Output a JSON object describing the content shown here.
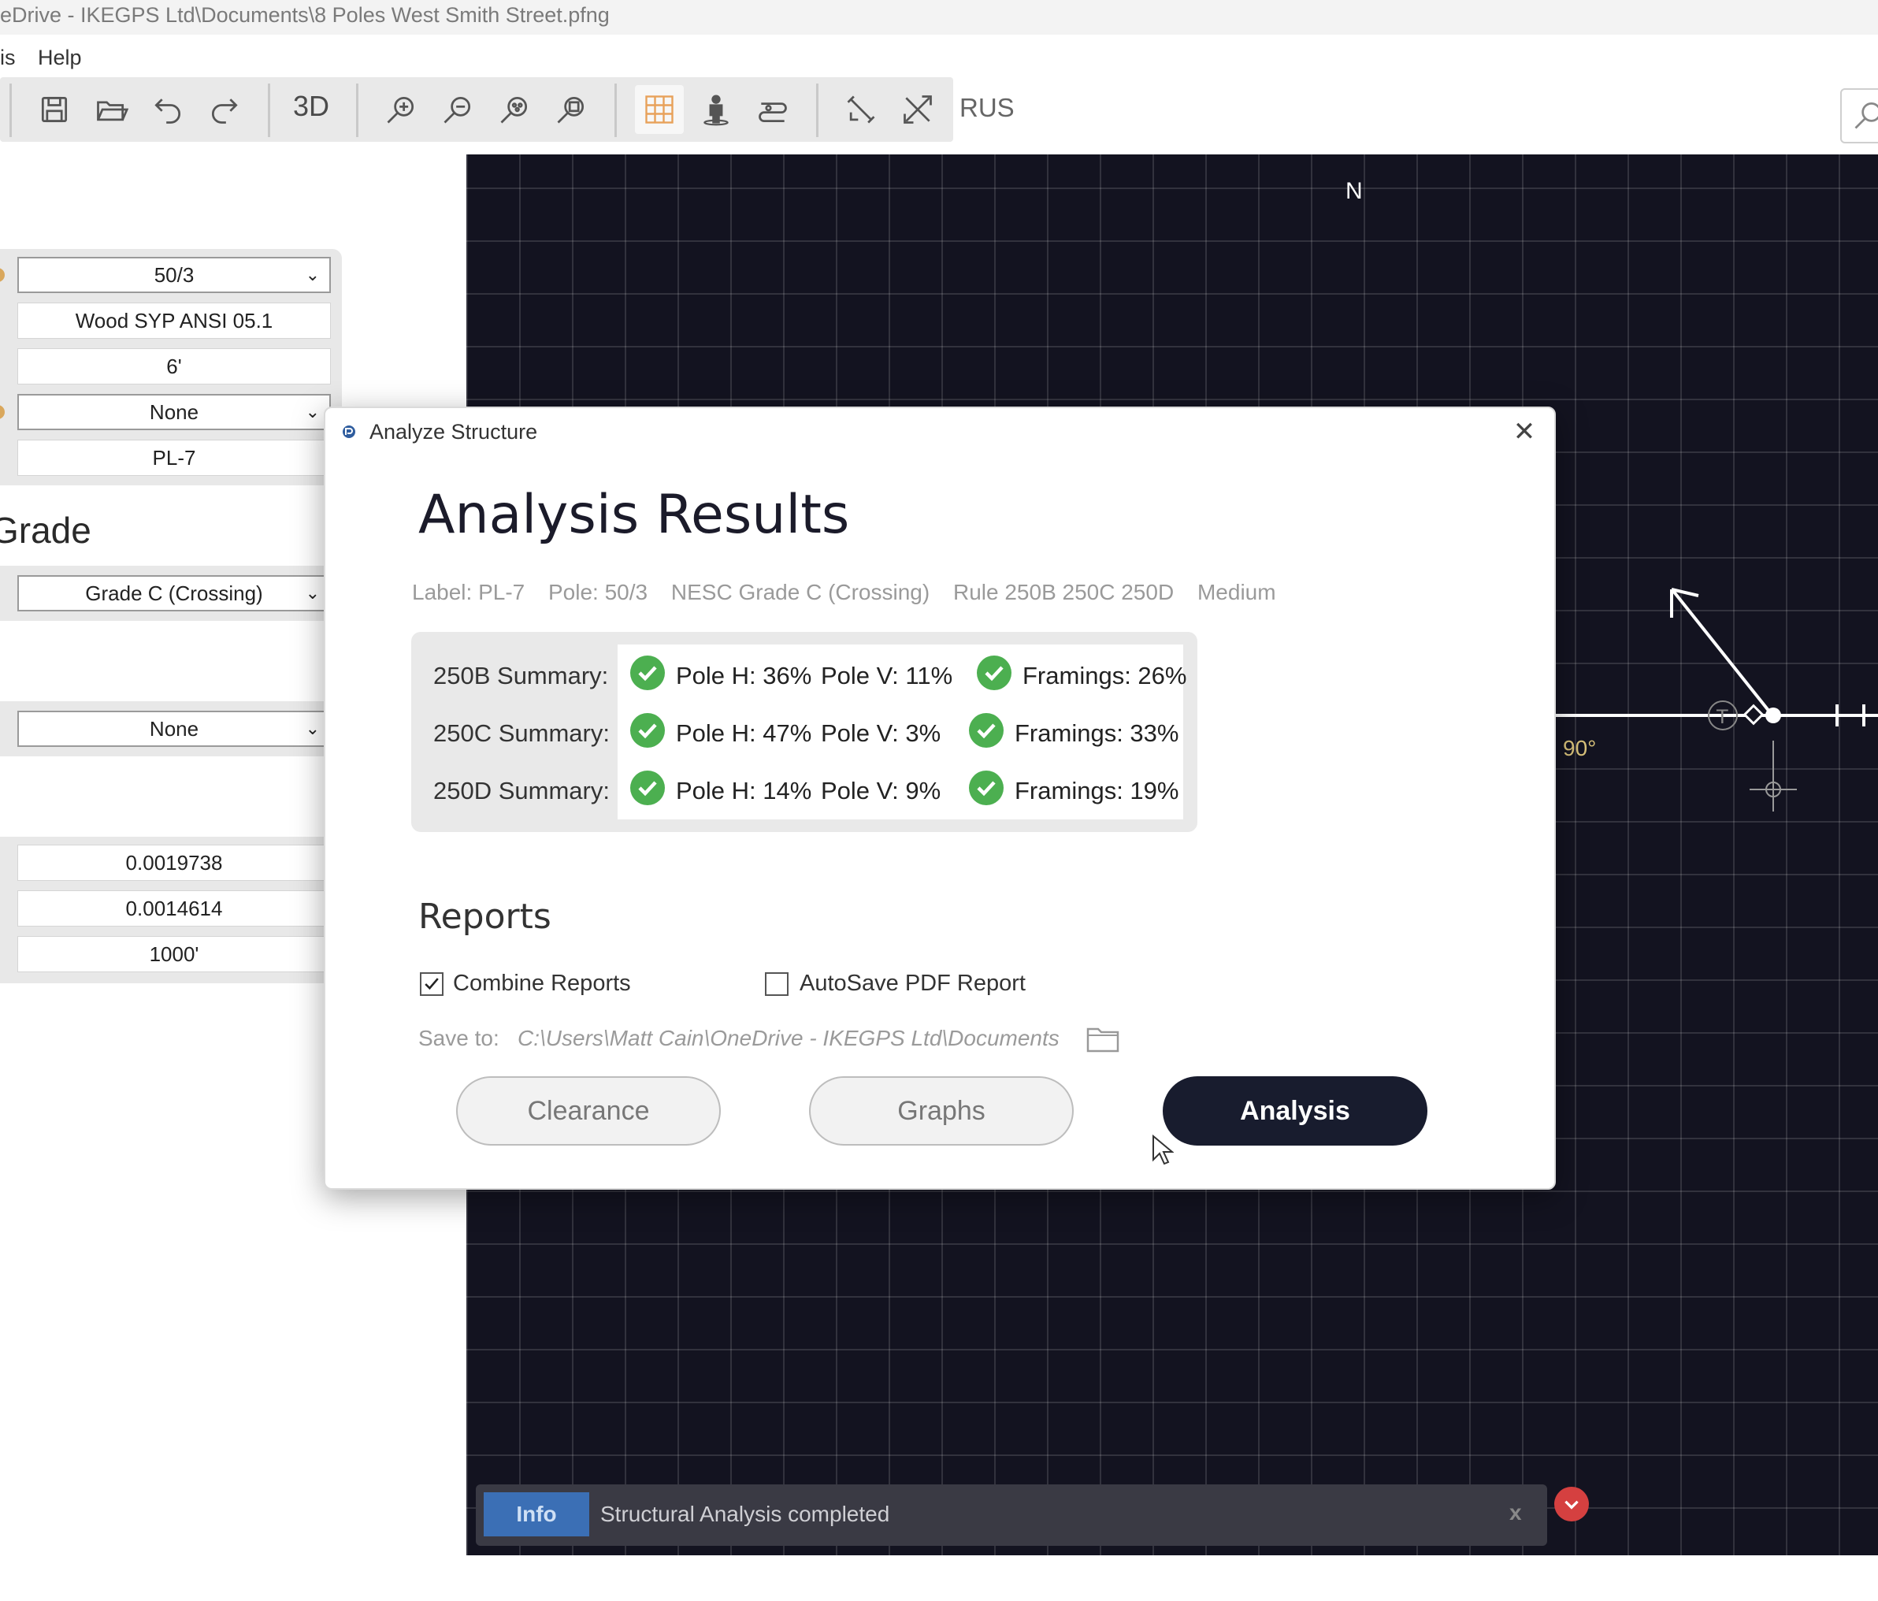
{
  "window": {
    "title": "eDrive - IKEGPS Ltd\\Documents\\8 Poles West Smith Street.pfng"
  },
  "menu": {
    "items": [
      "is",
      "Help"
    ]
  },
  "toolbar": {
    "view_3d_label": "3D",
    "rus_label": "RUS",
    "icons": [
      "save-icon",
      "open-folder-icon",
      "undo-icon",
      "redo-icon",
      "zoom-in-icon",
      "zoom-out-icon",
      "zoom-fit-icon",
      "zoom-reset-icon",
      "grid-icon",
      "person-icon",
      "span-icon",
      "measure-icon",
      "guy-icon",
      "search-icon"
    ]
  },
  "left_panel": {
    "pole_class": "50/3",
    "species": "Wood SYP ANSI 05.1",
    "setting_depth": "6'",
    "option_none_1": "None",
    "label": "PL-7",
    "grade_heading": "Grade",
    "grade": "Grade C (Crossing)",
    "option_none_2": "None",
    "value_1": "0.0019738",
    "value_2": "0.0014614",
    "value_3": "1000'"
  },
  "canvas": {
    "north_label": "N",
    "angle_label": "90°",
    "background": "#131320"
  },
  "dialog": {
    "title": "Analyze Structure",
    "close": "✕",
    "heading": "Analysis Results",
    "meta": {
      "label": "Label: PL-7",
      "pole": "Pole: 50/3",
      "grade": "NESC Grade C (Crossing)",
      "rule": "Rule 250B 250C 250D",
      "loading": "Medium"
    },
    "summaries": [
      {
        "label": "250B Summary:",
        "pole_h": "Pole H: 36%",
        "pole_v": "Pole V: 11%",
        "framings": "Framings: 26%"
      },
      {
        "label": "250C Summary:",
        "pole_h": "Pole H: 47%",
        "pole_v": "Pole V: 3%",
        "framings": "Framings: 33%"
      },
      {
        "label": "250D Summary:",
        "pole_h": "Pole H: 14%",
        "pole_v": "Pole V: 9%",
        "framings": "Framings: 19%"
      }
    ],
    "pass_color": "#4caf50",
    "reports_heading": "Reports",
    "combine_reports": {
      "label": "Combine Reports",
      "checked": true
    },
    "autosave_pdf": {
      "label": "AutoSave PDF Report",
      "checked": false
    },
    "save_to_label": "Save to:",
    "save_to_path": "C:\\Users\\Matt Cain\\OneDrive - IKEGPS Ltd\\Documents",
    "buttons": {
      "clearance": "Clearance",
      "graphs": "Graphs",
      "analysis": "Analysis"
    }
  },
  "status_bar": {
    "badge": "Info",
    "message": "Structural Analysis completed",
    "close": "x"
  }
}
